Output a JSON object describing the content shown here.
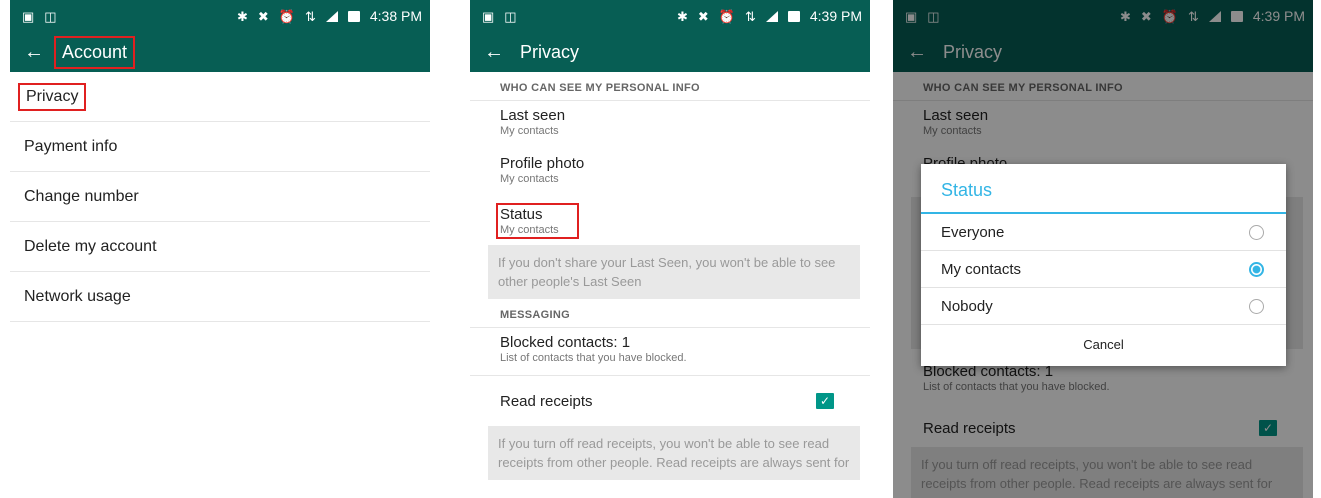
{
  "status_bar": {
    "left_icons": [
      "gallery-icon",
      "screenshot-icon"
    ],
    "right_icons": [
      "bluetooth-icon",
      "mute-icon",
      "alarm-icon",
      "network-h-icon",
      "signal-icon",
      "battery-icon"
    ],
    "time_1": "4:38 PM",
    "time_2": "4:39 PM",
    "time_3": "4:39 PM"
  },
  "screen1": {
    "title": "Account",
    "items": [
      "Privacy",
      "Payment info",
      "Change number",
      "Delete my account",
      "Network usage"
    ]
  },
  "screen2": {
    "title": "Privacy",
    "section_personal": "WHO CAN SEE MY PERSONAL INFO",
    "last_seen": {
      "title": "Last seen",
      "value": "My contacts"
    },
    "profile_photo": {
      "title": "Profile photo",
      "value": "My contacts"
    },
    "status": {
      "title": "Status",
      "value": "My contacts"
    },
    "last_seen_note": "If you don't share your Last Seen, you won't be able to see other people's Last Seen",
    "section_messaging": "MESSAGING",
    "blocked": {
      "title": "Blocked contacts: 1",
      "value": "List of contacts that you have blocked."
    },
    "read_receipts": {
      "title": "Read receipts",
      "checked": true
    },
    "read_receipts_note": "If you turn off read receipts, you won't be able to see read receipts from other people. Read receipts are always sent for"
  },
  "screen3": {
    "title": "Privacy",
    "section_personal": "WHO CAN SEE MY PERSONAL INFO",
    "last_seen": {
      "title": "Last seen",
      "value": "My contacts"
    },
    "profile_photo_title": "Profile photo",
    "blocked_title": "Blocked contacts: 1",
    "blocked_value": "List of contacts that you have blocked.",
    "read_receipts_title": "Read receipts",
    "read_receipts_note": "If you turn off read receipts, you won't be able to see read receipts from other people. Read receipts are always sent for",
    "dialog": {
      "title": "Status",
      "options": [
        {
          "label": "Everyone",
          "selected": false
        },
        {
          "label": "My contacts",
          "selected": true
        },
        {
          "label": "Nobody",
          "selected": false
        }
      ],
      "cancel_label": "Cancel"
    }
  },
  "colors": {
    "app_bar": "#075e54",
    "dialog_accent": "#33b5e5",
    "checkbox": "#009688",
    "highlight_box": "#e02020"
  }
}
